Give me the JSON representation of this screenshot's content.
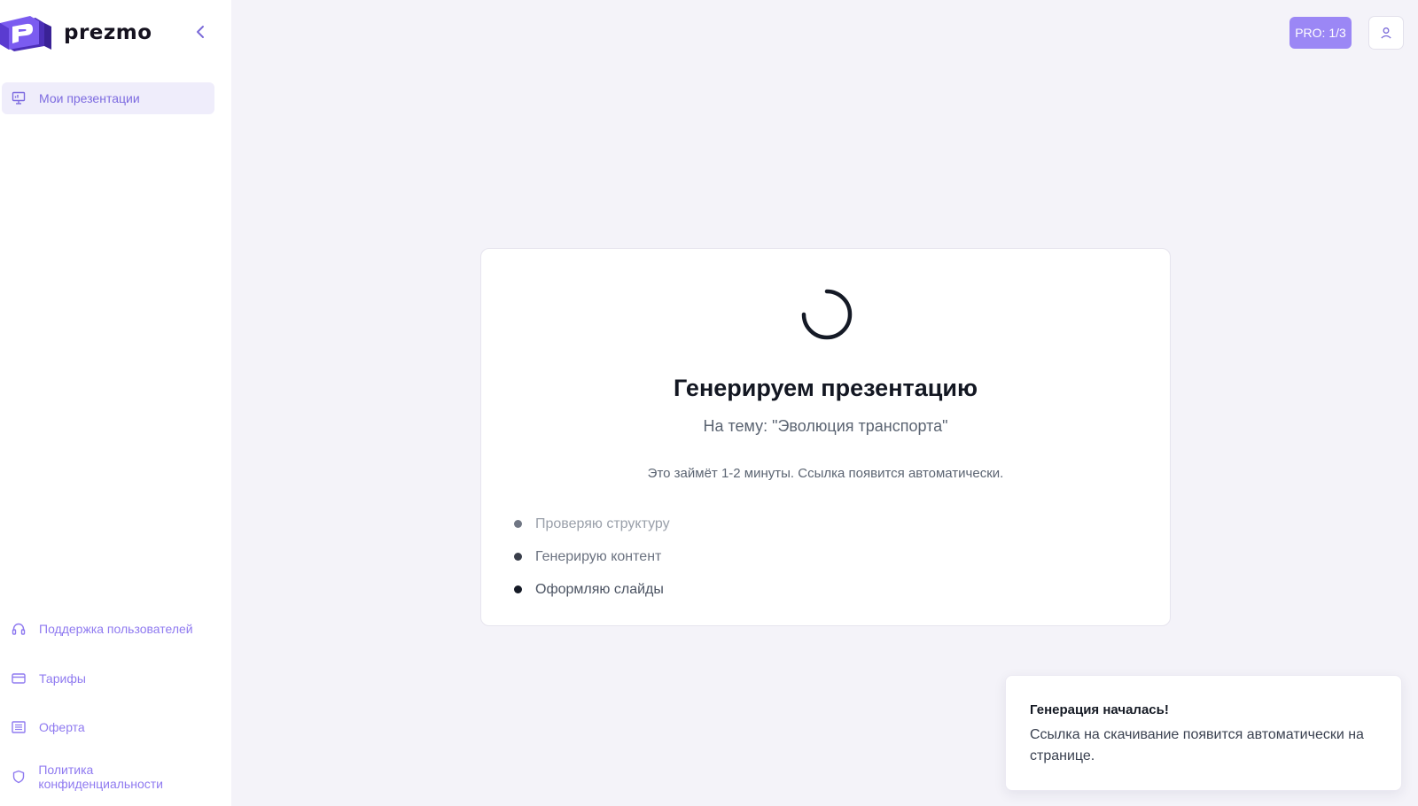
{
  "app": {
    "brand": "prezmo",
    "colors": {
      "accent": "#9b87f5",
      "sidebar_text": "#8f7af0",
      "background": "#f4f3f9"
    }
  },
  "sidebar": {
    "collapse_icon": "chevron-left-icon",
    "top_items": [
      {
        "label": "Мои презентации",
        "icon": "presentation-icon",
        "active": true
      }
    ],
    "bottom_items": [
      {
        "label": "Поддержка пользователей",
        "icon": "headphones-icon"
      },
      {
        "label": "Тарифы",
        "icon": "credit-card-icon"
      },
      {
        "label": "Оферта",
        "icon": "document-list-icon"
      },
      {
        "label": "Политика конфиденциальности",
        "icon": "shield-icon"
      }
    ]
  },
  "header": {
    "pro_badge": "PRO: 1/3",
    "profile_icon": "user-icon"
  },
  "main": {
    "title": "Генерируем презентацию",
    "subtitle": "На тему: \"Эволюция транспорта\"",
    "note": "Это займёт 1-2 минуты. Ссылка появится автоматически.",
    "steps": [
      {
        "label": "Проверяю структуру"
      },
      {
        "label": "Генерирую контент"
      },
      {
        "label": "Оформляю слайды"
      }
    ]
  },
  "toast": {
    "title": "Генерация началась!",
    "message": "Ссылка на скачивание появится автоматически на странице."
  }
}
